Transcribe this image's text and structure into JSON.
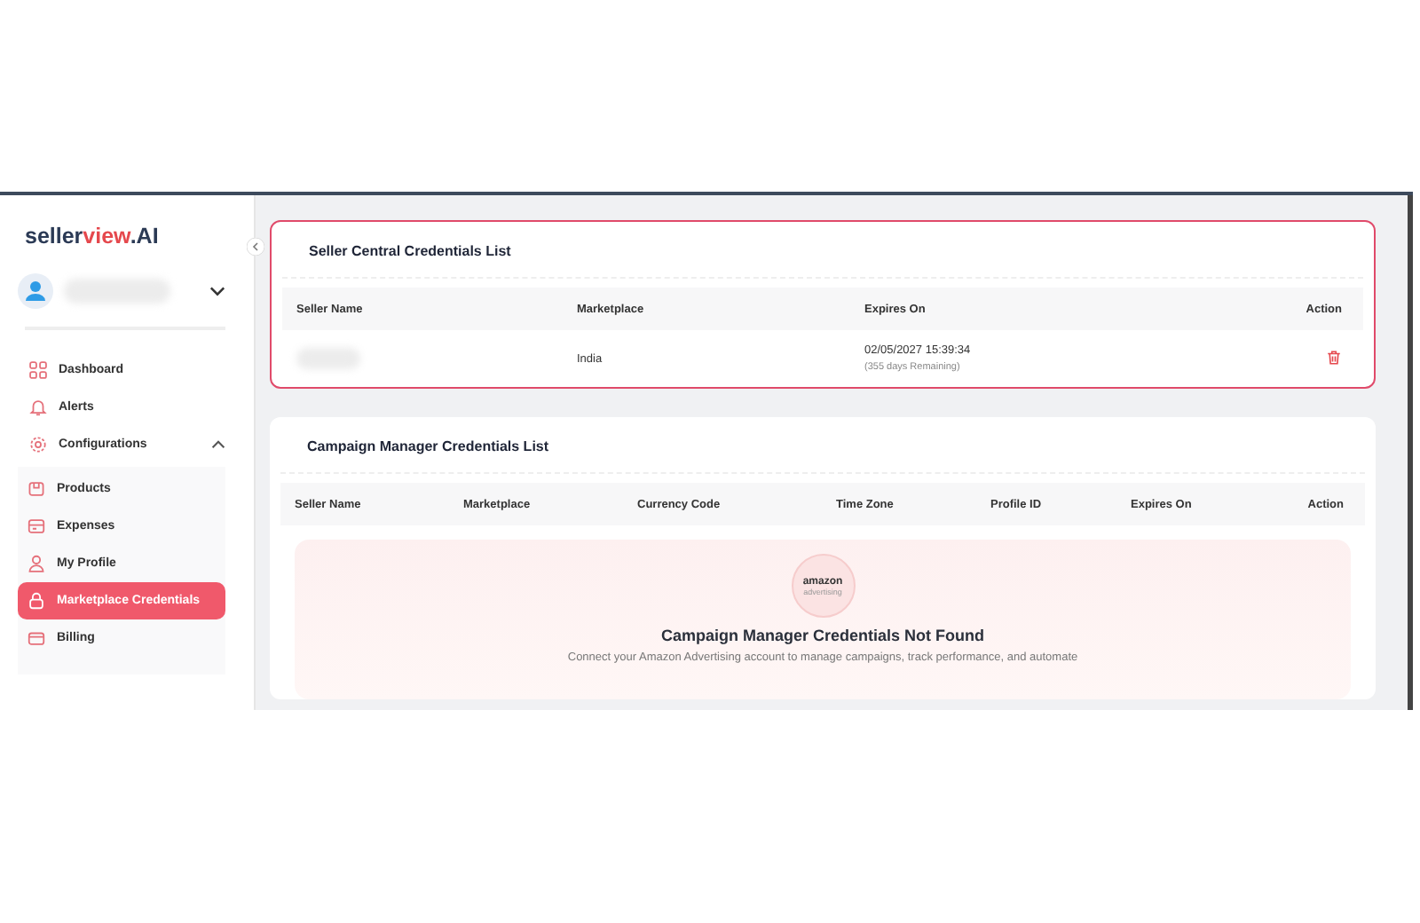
{
  "logo": {
    "parts": [
      {
        "text": "seller",
        "accent": false
      },
      {
        "text": "view",
        "accent": true
      },
      {
        "text": ".AI",
        "accent": false
      }
    ]
  },
  "sidebar": {
    "items": [
      {
        "label": "Dashboard",
        "selected": false
      },
      {
        "label": "Alerts",
        "selected": false
      },
      {
        "label": "Configurations",
        "selected": false,
        "expanded": true,
        "children": [
          {
            "label": "Products",
            "selected": false
          },
          {
            "label": "Expenses",
            "selected": false
          },
          {
            "label": "My Profile",
            "selected": false
          },
          {
            "label": "Marketplace Credentials",
            "selected": true
          },
          {
            "label": "Billing",
            "selected": false
          }
        ]
      }
    ]
  },
  "seller_central": {
    "title": "Seller Central Credentials List",
    "columns": [
      "Seller Name",
      "Marketplace",
      "Expires On",
      "Action"
    ],
    "rows": [
      {
        "marketplace": "India",
        "expires": "02/05/2027 15:39:34",
        "remaining": "(355 days Remaining)"
      }
    ]
  },
  "campaign_manager": {
    "title": "Campaign Manager Credentials List",
    "columns": [
      "Seller Name",
      "Marketplace",
      "Currency Code",
      "Time Zone",
      "Profile ID",
      "Expires On",
      "Action"
    ],
    "empty": {
      "logo_word": "amazon",
      "logo_sub": "advertising",
      "title": "Campaign Manager Credentials Not Found",
      "message": "Connect your Amazon Advertising account to manage campaigns, track performance, and automate"
    }
  }
}
